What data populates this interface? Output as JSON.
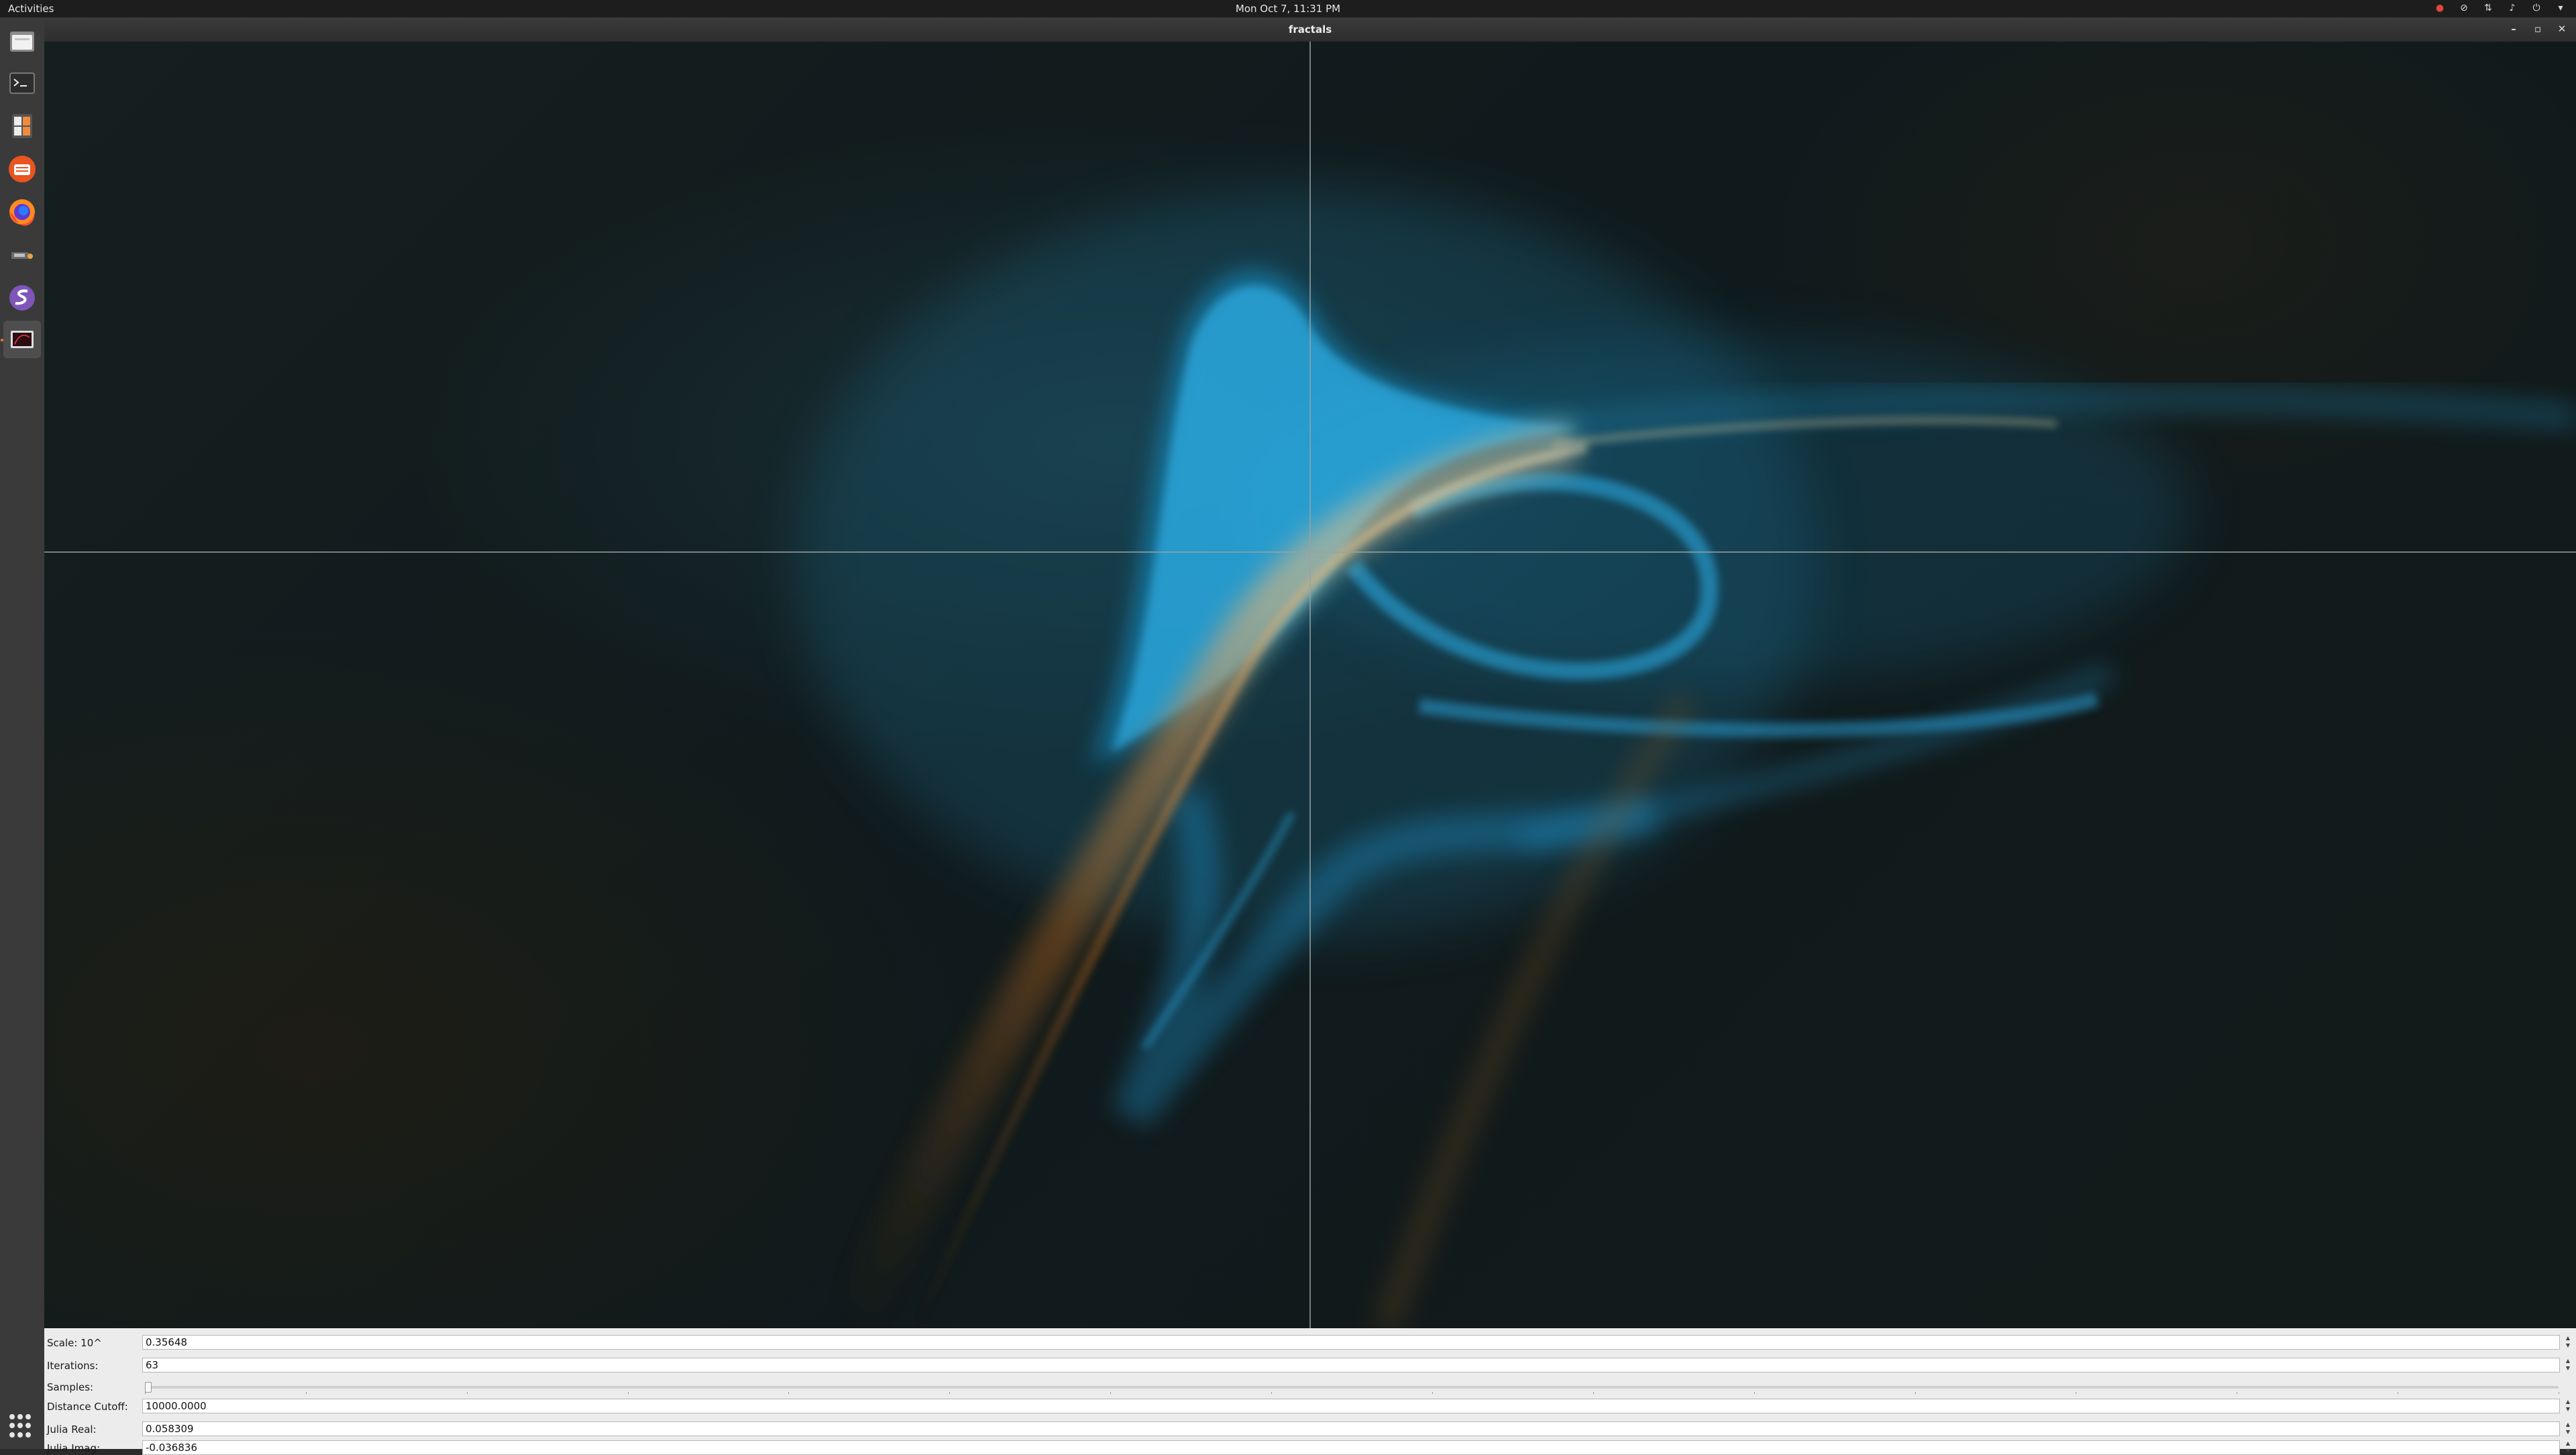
{
  "topbar": {
    "activities": "Activities",
    "clock": "Mon Oct  7, 11:31 PM",
    "tray_icons": [
      "record-icon",
      "network-off-icon",
      "network-icon",
      "volume-icon",
      "power-icon",
      "menu-caret-icon"
    ]
  },
  "dock": {
    "items": [
      "files-icon",
      "terminal-icon",
      "calculator-icon",
      "software-icon",
      "firefox-icon",
      "tools-icon",
      "emacs-icon",
      "screen-icon"
    ],
    "active_item": "screen-icon",
    "show_apps": "show-apps-icon"
  },
  "window": {
    "title": "fractals",
    "controls": [
      "minimize-icon",
      "maximize-icon",
      "close-icon"
    ]
  },
  "fields": {
    "scale_label": "Scale: 10^",
    "scale_value": "0.35648",
    "iterations_label": "Iterations:",
    "iterations_value": "63",
    "samples_label": "Samples:",
    "samples_level": 0,
    "distance_label": "Distance Cutoff:",
    "distance_value": "10000.0000",
    "julia_real_label": "Julia Real:",
    "julia_real_value": "0.058309",
    "julia_imag_label": "Julia Imag:",
    "julia_imag_value": "-0.036836"
  },
  "colors": {
    "fractal_primary": "#29aee8",
    "fractal_secondary": "#d9a25a",
    "background": "#121b1c"
  }
}
